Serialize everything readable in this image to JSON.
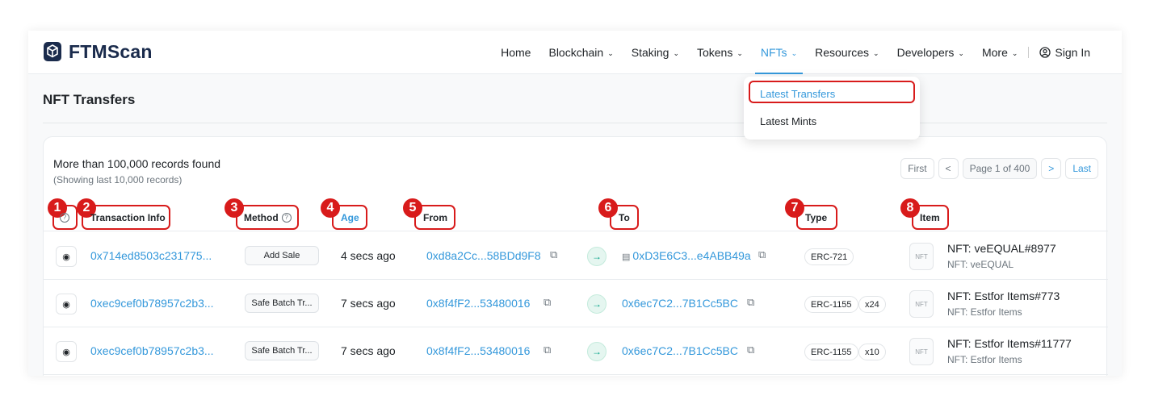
{
  "brand": {
    "name": "FTMScan"
  },
  "nav": {
    "items": [
      {
        "label": "Home",
        "chevron": false,
        "active": false
      },
      {
        "label": "Blockchain",
        "chevron": true,
        "active": false
      },
      {
        "label": "Staking",
        "chevron": true,
        "active": false
      },
      {
        "label": "Tokens",
        "chevron": true,
        "active": false
      },
      {
        "label": "NFTs",
        "chevron": true,
        "active": true
      },
      {
        "label": "Resources",
        "chevron": true,
        "active": false
      },
      {
        "label": "Developers",
        "chevron": true,
        "active": false
      },
      {
        "label": "More",
        "chevron": true,
        "active": false
      }
    ],
    "sign_in": "Sign In"
  },
  "dropdown": {
    "items": [
      "Latest Transfers",
      "Latest Mints"
    ]
  },
  "page": {
    "title": "NFT Transfers"
  },
  "summary": {
    "records": "More than 100,000 records found",
    "showing": "(Showing last 10,000 records)"
  },
  "pager": {
    "first": "First",
    "prev": "<",
    "page": "Page 1 of 400",
    "next": ">",
    "last": "Last"
  },
  "columns": {
    "info_icon": "?",
    "transaction_info": "Transaction Info",
    "method": "Method",
    "age": "Age",
    "from": "From",
    "to": "To",
    "type": "Type",
    "item": "Item"
  },
  "annotations": [
    "1",
    "2",
    "3",
    "4",
    "5",
    "6",
    "7",
    "8"
  ],
  "rows": [
    {
      "tx": "0x714ed8503c231775...",
      "method": "Add Sale",
      "age": "4 secs ago",
      "from": "0xd8a2Cc...58BDd9F8",
      "to": "0xD3E6C3...e4ABB49a",
      "to_is_contract": true,
      "type": "ERC-721",
      "qty": "",
      "item_name": "NFT: veEQUAL#8977",
      "item_collection": "NFT: veEQUAL",
      "nft_placeholder": "NFT"
    },
    {
      "tx": "0xec9cef0b78957c2b3...",
      "method": "Safe Batch Tr...",
      "age": "7 secs ago",
      "from": "0x8f4fF2...53480016",
      "to": "0x6ec7C2...7B1Cc5BC",
      "to_is_contract": false,
      "type": "ERC-1155",
      "qty": "x24",
      "item_name": "NFT: Estfor Items#773",
      "item_collection": "NFT: Estfor Items",
      "nft_placeholder": "NFT"
    },
    {
      "tx": "0xec9cef0b78957c2b3...",
      "method": "Safe Batch Tr...",
      "age": "7 secs ago",
      "from": "0x8f4fF2...53480016",
      "to": "0x6ec7C2...7B1Cc5BC",
      "to_is_contract": false,
      "type": "ERC-1155",
      "qty": "x10",
      "item_name": "NFT: Estfor Items#11777",
      "item_collection": "NFT: Estfor Items",
      "nft_placeholder": "NFT"
    }
  ],
  "colors": {
    "accent": "#3498db",
    "highlight": "#d81b1b",
    "arrow_green": "#00a186"
  }
}
